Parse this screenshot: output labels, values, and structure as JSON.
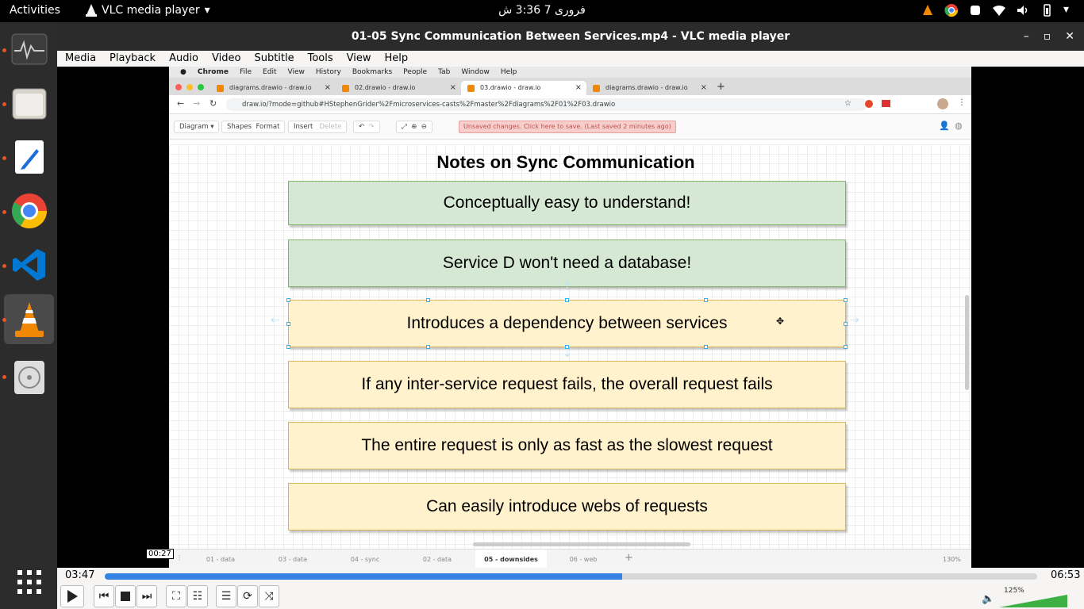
{
  "topbar": {
    "activities": "Activities",
    "app_name": "VLC media player",
    "clock": "فروری 7  3:36 ش"
  },
  "window": {
    "title": "01-05 Sync Communication Between Services.mp4 - VLC media player"
  },
  "menu": [
    "Media",
    "Playback",
    "Audio",
    "Video",
    "Subtitle",
    "Tools",
    "View",
    "Help"
  ],
  "mac_menu": [
    "Chrome",
    "File",
    "Edit",
    "View",
    "History",
    "Bookmarks",
    "People",
    "Tab",
    "Window",
    "Help"
  ],
  "browser_tabs": [
    {
      "label": "diagrams.drawio - draw.io",
      "active": false
    },
    {
      "label": "02.drawio - draw.io",
      "active": false
    },
    {
      "label": "03.drawio - draw.io",
      "active": true
    },
    {
      "label": "diagrams.drawio - draw.io",
      "active": false
    }
  ],
  "address": {
    "url": "draw.io/?mode=github#HStephenGrider%2Fmicroservices-casts%2Fmaster%2Fdiagrams%2F01%2F03.drawio"
  },
  "drawio_toolbar": {
    "diagram": "Diagram",
    "shapes": "Shapes",
    "format": "Format",
    "insert": "Insert",
    "delete": "Delete",
    "unsaved": "Unsaved changes. Click here to save. (Last saved 2 minutes ago)"
  },
  "diagram": {
    "title": "Notes on Sync Communication",
    "notes": [
      {
        "text": "Conceptually easy to understand!",
        "color": "#d5e8d4"
      },
      {
        "text": "Service D won't need a database!",
        "color": "#d5e8d4"
      },
      {
        "text": "Introduces a dependency between services",
        "color": "#fff2cc"
      },
      {
        "text": "If any inter-service request fails, the overall request fails",
        "color": "#fff2cc"
      },
      {
        "text": "The entire request is only as fast as the slowest request",
        "color": "#fff2cc"
      },
      {
        "text": "Can easily introduce webs of requests",
        "color": "#fff2cc"
      }
    ]
  },
  "page_tabs": [
    {
      "label": "01 - data",
      "active": false
    },
    {
      "label": "03 - data",
      "active": false
    },
    {
      "label": "04 - sync",
      "active": false
    },
    {
      "label": "02 - data",
      "active": false
    },
    {
      "label": "05 - downsides",
      "active": true
    },
    {
      "label": "06 - web",
      "active": false
    }
  ],
  "zoom": "130%",
  "player": {
    "elapsed": "03:47",
    "total": "06:53",
    "progress": 0.555,
    "hover_time": "00:27",
    "volume": "125%"
  }
}
